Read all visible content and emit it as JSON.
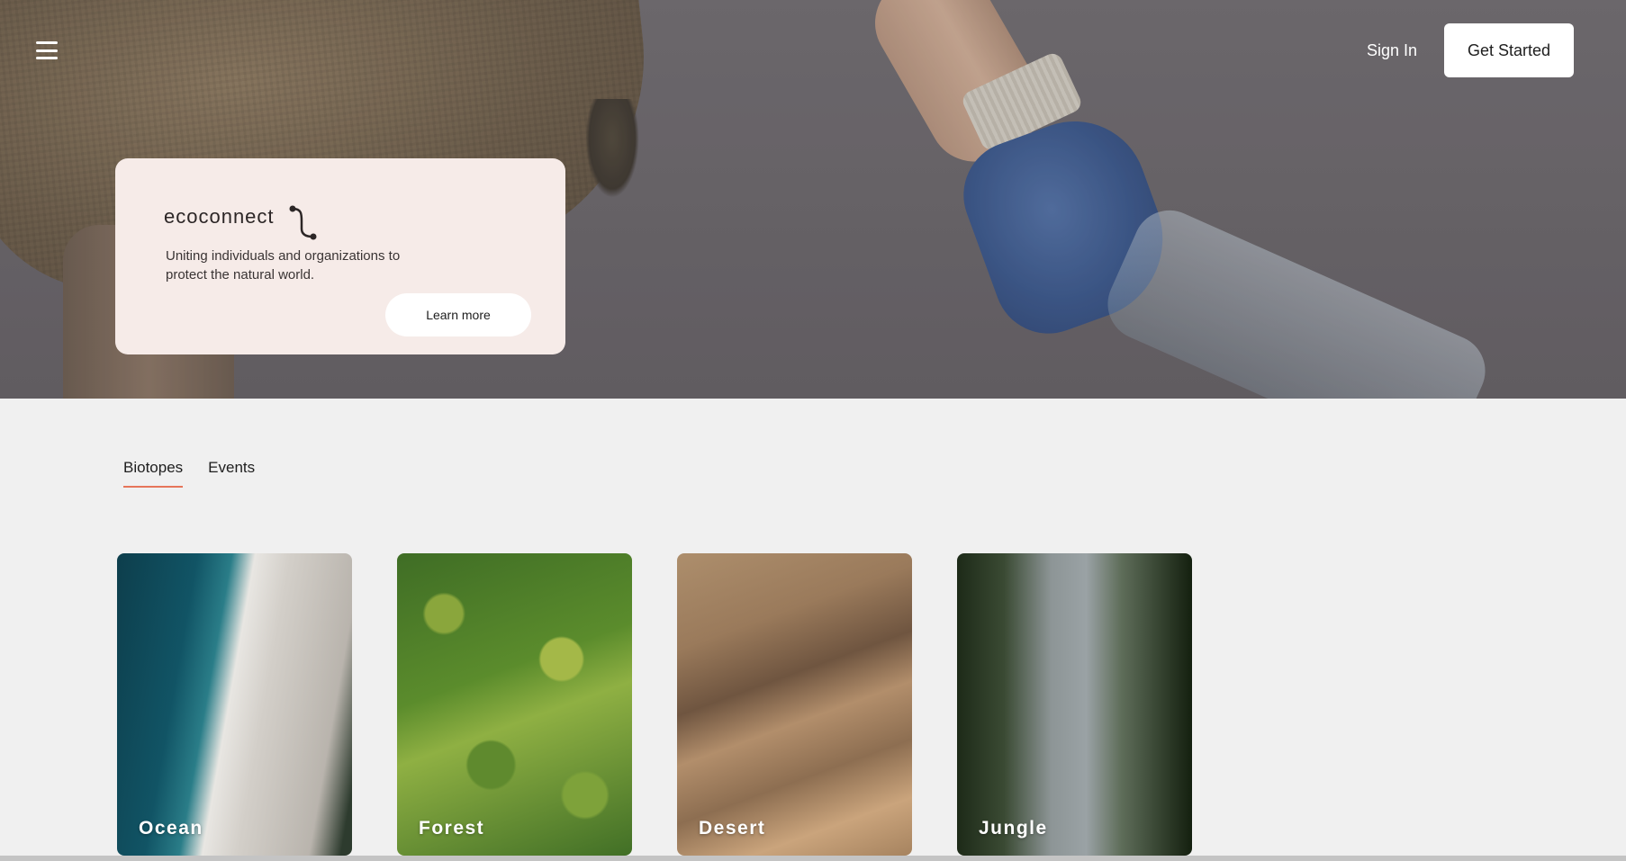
{
  "header": {
    "sign_in_label": "Sign In",
    "get_started_label": "Get Started",
    "menu_icon": "hamburger-menu-icon"
  },
  "intro": {
    "brand": "ecoconnect",
    "tagline": "Uniting individuals and organizations to protect the natural world.",
    "learn_more_label": "Learn more"
  },
  "tabs": [
    {
      "label": "Biotopes",
      "active": true
    },
    {
      "label": "Events",
      "active": false
    }
  ],
  "biotopes": [
    {
      "label": "Ocean"
    },
    {
      "label": "Forest"
    },
    {
      "label": "Desert"
    },
    {
      "label": "Jungle"
    }
  ],
  "colors": {
    "accent": "#e6755a",
    "card_bg": "#f6ebe8",
    "page_bg": "#f0f0f0"
  }
}
